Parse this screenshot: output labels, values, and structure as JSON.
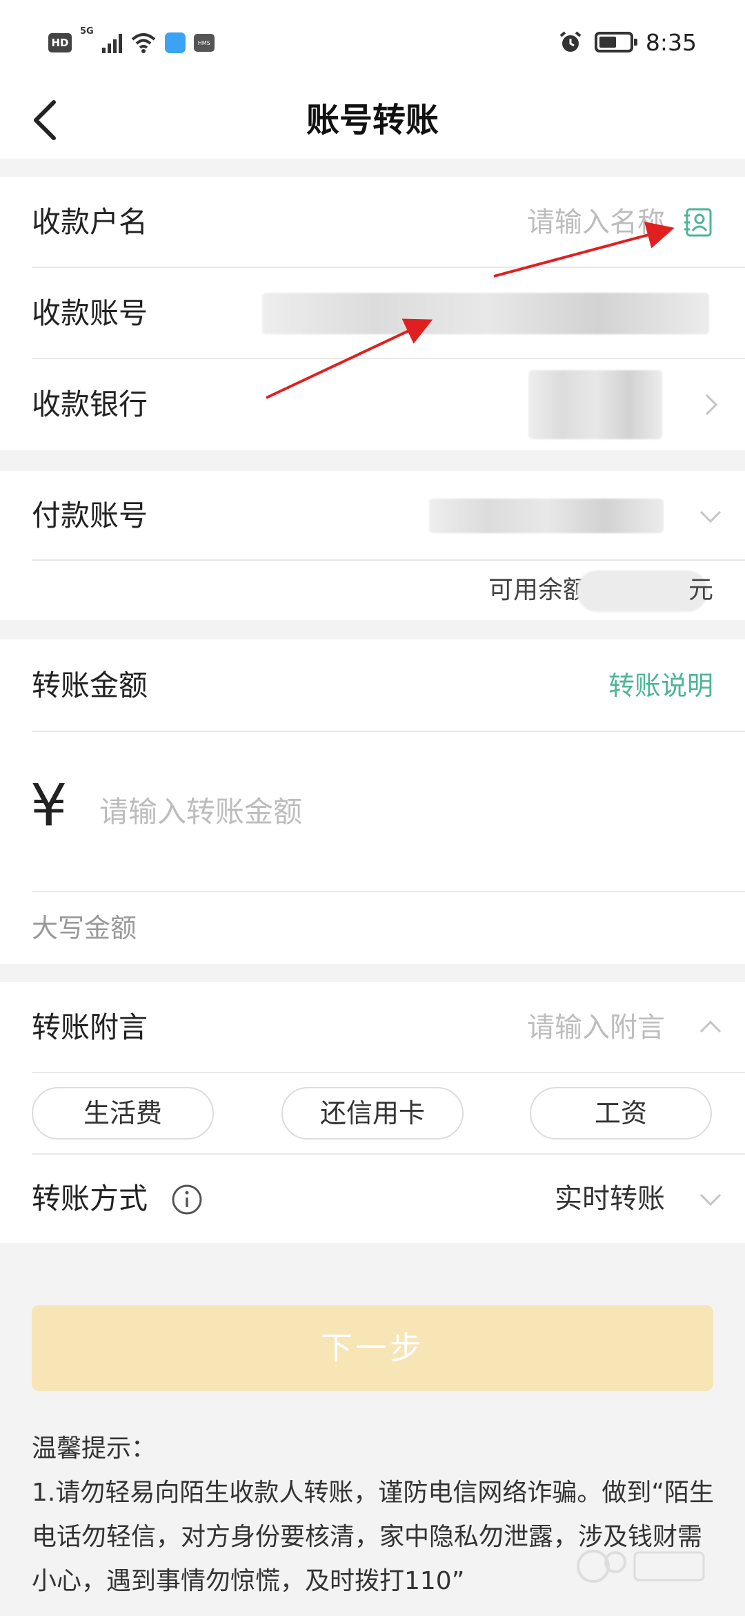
{
  "status_bar": {
    "hd": "HD",
    "network": "5G",
    "hms": "HMS",
    "time": "8:35"
  },
  "navbar": {
    "title": "账号转账"
  },
  "payee": {
    "name_label": "收款户名",
    "name_placeholder": "请输入名称",
    "account_label": "收款账号",
    "bank_label": "收款银行"
  },
  "payer": {
    "account_label": "付款账号",
    "balance_prefix": "可用余额",
    "balance_suffix": "元"
  },
  "amount": {
    "label": "转账金额",
    "info_link": "转账说明",
    "currency_symbol": "¥",
    "placeholder": "请输入转账金额",
    "uppercase_label": "大写金额"
  },
  "remark": {
    "label": "转账附言",
    "placeholder": "请输入附言",
    "chips": [
      "生活费",
      "还信用卡",
      "工资"
    ]
  },
  "method": {
    "label": "转账方式",
    "value": "实时转账"
  },
  "next_button": "下一步",
  "tips": {
    "title": "温馨提示：",
    "line1": "1.请勿轻易向陌生收款人转账，谨防电信网络诈骗。做到“陌生电话勿轻信，对方身份要核清，家中隐私勿泄露，涉及钱财需小心，遇到事情勿惊慌，及时拨打110”"
  },
  "colors": {
    "accent": "#4db596",
    "button_disabled": "#f7e5b6",
    "arrow": "#e02020"
  }
}
